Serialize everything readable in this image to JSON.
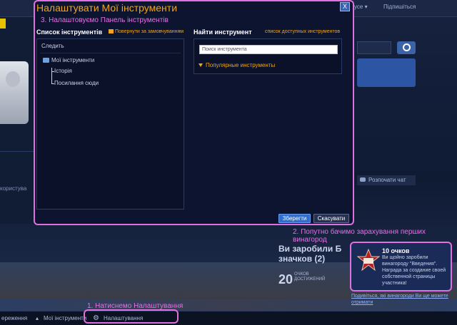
{
  "dialog": {
    "title": "Налаштувати Мої інструменти",
    "close_label": "X",
    "step3": "3. Налаштовуємо Панель інструментів",
    "left": {
      "heading": "Список інструментів",
      "reset_link": "Повернути за замовчуванням",
      "follow_label": "Следить",
      "folder_label": "Мої інструменти",
      "items": [
        "Історія",
        "Посилання сюди"
      ]
    },
    "right": {
      "heading": "Найти инструмент",
      "available_link": "список доступных инструментов",
      "search_placeholder": "Поиск инструмента",
      "popular_label": "Популярные инструменты"
    },
    "save_label": "Зберегти",
    "cancel_label": "Скасувати"
  },
  "annotations": {
    "step1": "1. Натиснемо Налаштування",
    "step2": "2. Попутно бачимо зарахування перших винагород"
  },
  "badge": {
    "title": "10 очков",
    "text": "Ви щойно заробили винагороду \"Введения\". Награда за создание своей собственной страницы участника!",
    "link": "Подивіться, які винагороди Ви ще можете отримати"
  },
  "background": {
    "topbar_dropdown": "усе ▾",
    "topbar_signup": "Підпишіться",
    "left_text": "користува",
    "chat_label": "Розпочати чат",
    "earned_title": "Ви заробили Б значков (2)",
    "score_value": "20",
    "score_unit": "ОЧКОВ ДОСТИЖЕНИЙ",
    "bottom_changes": "ереження",
    "bottom_tools": "Мої інструменти",
    "bottom_settings": "Налаштування"
  },
  "colors": {
    "accent_orange": "#f2a51a",
    "annotation_pink": "#e06fe0",
    "save_button": "#2f6fd0"
  }
}
